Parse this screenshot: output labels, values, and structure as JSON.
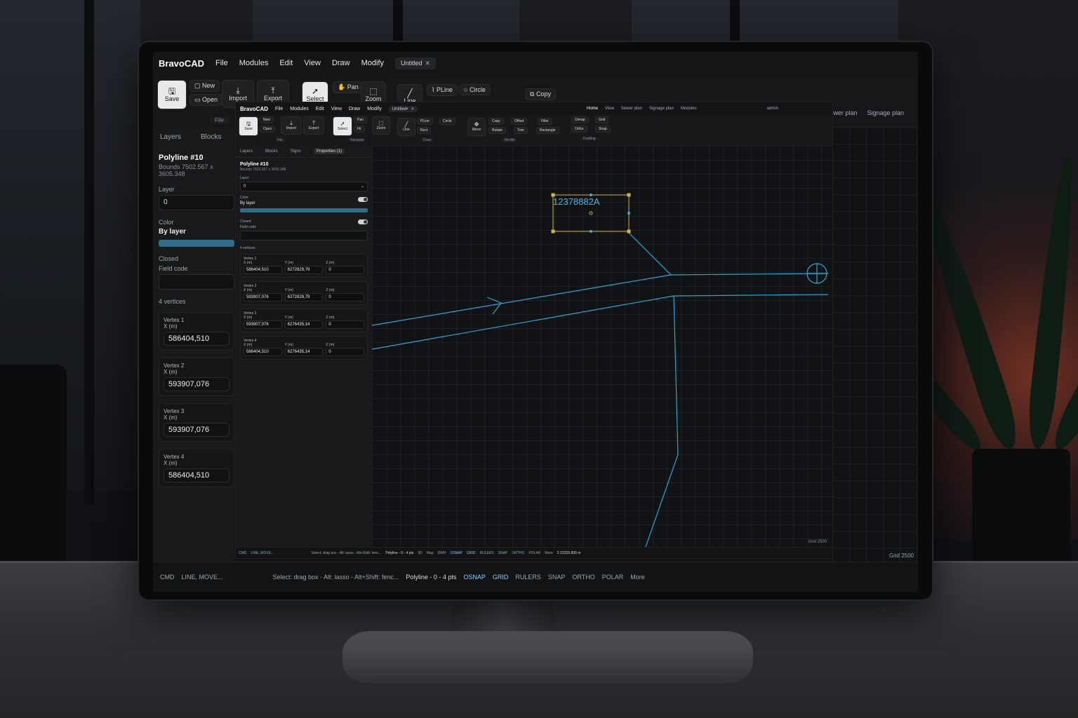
{
  "app": {
    "name": "BravoCAD",
    "menus": [
      "File",
      "Modules",
      "Edit",
      "View",
      "Draw",
      "Modify"
    ],
    "document_tab": "Untitled",
    "document_tab_small": "Untitled•"
  },
  "ribbon": {
    "save": "Save",
    "new": "New",
    "open": "Open",
    "import": "Import",
    "export": "Export",
    "select": "Select",
    "pan": "Pan",
    "fit": "Fit",
    "zoom": "Zoom",
    "line": "Line",
    "pline": "PLine",
    "circle": "Circle",
    "rect": "Rect",
    "move": "Move",
    "copy": "Copy",
    "offset": "Offset",
    "fillet": "Fillet",
    "rotate": "Rotate",
    "trim": "Trim",
    "rectangle": "Rectangle",
    "osnap": "Osnap",
    "grid": "Grid",
    "ortho": "Ortho",
    "snap": "Snap",
    "groups": {
      "file": "File",
      "navigate": "Navigate",
      "draw": "Draw",
      "modify": "Modify",
      "drafting": "Drafting"
    },
    "workspace_tabs": [
      "Home",
      "View",
      "Sewer plan",
      "Signage plan",
      "Modules"
    ],
    "user": "admin"
  },
  "panel": {
    "tabs": [
      "Layers",
      "Blocks",
      "Signs",
      "Properties (1)"
    ],
    "title": "Polyline #10",
    "bounds": "Bounds 7502.567 x 3605.348",
    "layer_label": "Layer",
    "layer_value": "0",
    "color_label": "Color",
    "color_value": "By layer",
    "color_swatch": "#2f6d8a",
    "closed_label": "Closed",
    "field_code_label": "Field code",
    "field_code_value": "",
    "vertex_count": "4 vertices",
    "vertices": [
      {
        "label": "Vertex 1",
        "x": "586404,510",
        "y": "6272829,79",
        "z": "0"
      },
      {
        "label": "Vertex 2",
        "x": "593907,076",
        "y": "6272829,79",
        "z": "0"
      },
      {
        "label": "Vertex 3",
        "x": "593907,076",
        "y": "6276435,14",
        "z": "0"
      },
      {
        "label": "Vertex 4",
        "x": "586404,510",
        "y": "6276435,14",
        "z": "0"
      }
    ],
    "x_label": "X (m)",
    "y_label": "Y (m)",
    "z_label": "Z (m)"
  },
  "canvas": {
    "text_label": "12378882A",
    "grid_readout": "Grid 2500",
    "line_color": "#2aa7d6",
    "selection_color": "#d4b43a"
  },
  "status": {
    "cmd": "CMD",
    "cmd_placeholder": "LINE, MOVE...",
    "hint": "Select: drag box - Alt: lasso - Alt+Shift: fenc...",
    "selection_info": "Polyline - 0 - 4 pts",
    "toggles": [
      "3D",
      "Map",
      "DWH",
      "OSNAP",
      "GRID",
      "RULERS",
      "SNAP",
      "ORTHO",
      "POLAR"
    ],
    "active_toggles": [
      "OSNAP",
      "GRID"
    ],
    "more": "More",
    "length": "Σ 22215.830 m"
  }
}
